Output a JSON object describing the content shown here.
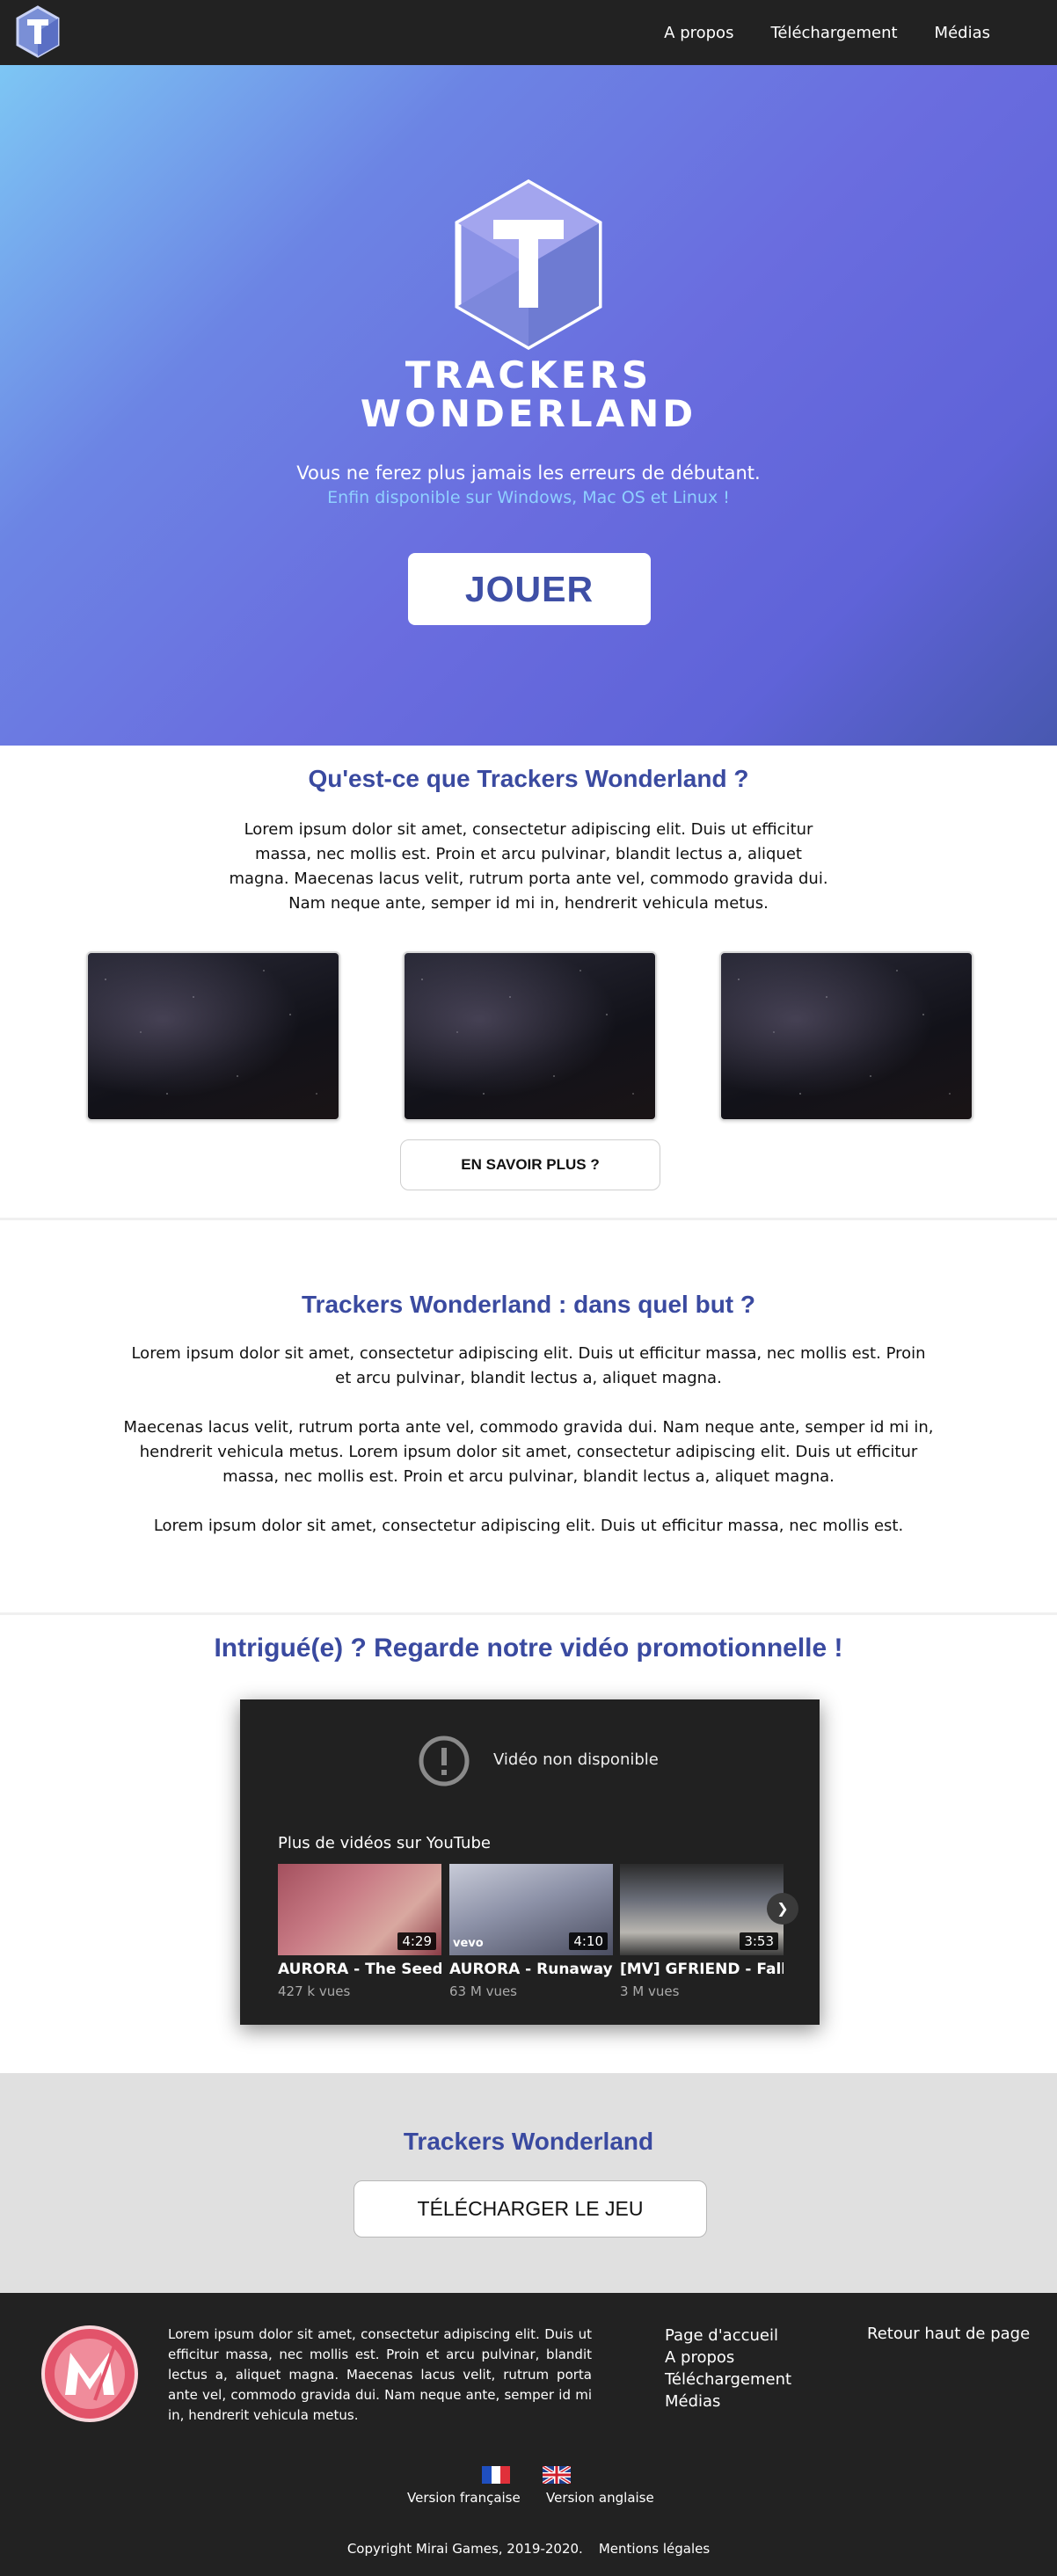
{
  "nav": {
    "links": [
      "A propos",
      "Téléchargement",
      "Médias"
    ]
  },
  "hero": {
    "title_line1": "TRACKERS",
    "title_line2": "WONDERLAND",
    "tagline": "Vous ne ferez plus jamais les erreurs de débutant.",
    "availability": "Enfin disponible sur Windows, Mac OS et Linux !",
    "play_label": "JOUER"
  },
  "about": {
    "title": "Qu'est-ce que Trackers Wonderland ?",
    "text": "Lorem ipsum dolor sit amet, consectetur adipiscing elit. Duis ut efficitur massa, nec mollis est. Proin et arcu pulvinar, blandit lectus a, aliquet magna. Maecenas lacus velit, rutrum porta ante vel, commodo gravida dui. Nam neque ante, semper id mi in, hendrerit vehicula metus.",
    "more_label": "EN SAVOIR PLUS ?"
  },
  "goal": {
    "title": "Trackers Wonderland : dans quel but ?",
    "p1": "Lorem ipsum dolor sit amet, consectetur adipiscing elit. Duis ut efficitur massa, nec mollis est. Proin et arcu pulvinar, blandit lectus a, aliquet magna.",
    "p2": "Maecenas lacus velit, rutrum porta ante vel, commodo gravida dui. Nam neque ante, semper id mi in, hendrerit vehicula metus. Lorem ipsum dolor sit amet, consectetur adipiscing elit. Duis ut efficitur massa, nec mollis est. Proin et arcu pulvinar, blandit lectus a, aliquet magna.",
    "p3": "Lorem ipsum dolor sit amet, consectetur adipiscing elit. Duis ut efficitur massa, nec mollis est."
  },
  "video": {
    "title": "Intrigué(e) ? Regarde notre vidéo promotionnelle !",
    "unavailable": "Vidéo non disponible",
    "more_videos": "Plus de vidéos sur YouTube",
    "items": [
      {
        "title": "AURORA - The Seed...",
        "views": "427 k vues",
        "duration": "4:29"
      },
      {
        "title": "AURORA - Runaway",
        "views": "63 M vues",
        "duration": "4:10"
      },
      {
        "title": "[MV] GFRIEND - Falli...",
        "views": "3 M vues",
        "duration": "3:53"
      }
    ],
    "vevo": "vevo"
  },
  "download": {
    "title": "Trackers Wonderland",
    "button": "TÉLÉCHARGER LE JEU"
  },
  "footer": {
    "text": "Lorem ipsum dolor sit amet, consectetur adipiscing elit. Duis ut efficitur massa, nec mollis est. Proin et arcu pulvinar, blandit lectus a, aliquet magna. Maecenas lacus velit, rutrum porta ante vel, commodo gravida dui. Nam neque ante, semper id mi in, hendrerit vehicula metus.",
    "links": [
      "Page d'accueil",
      "A propos",
      "Téléchargement",
      "Médias"
    ],
    "back_top": "Retour haut de page",
    "lang_fr": "Version française",
    "lang_en": "Version anglaise",
    "copyright": "Copyright Mirai Games, 2019-2020.",
    "legal": "Mentions légales"
  },
  "colors": {
    "accent": "#3a4aa0",
    "hero_start": "#7dc6f4",
    "hero_end": "#4858b0",
    "dark": "#222222"
  }
}
